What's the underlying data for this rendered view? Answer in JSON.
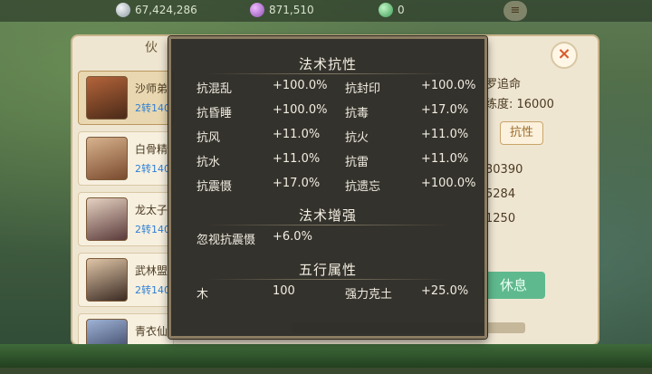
{
  "topbar": {
    "silver": "67,424,286",
    "gems": "871,510",
    "jade": "0"
  },
  "background_panel": {
    "title": "伙",
    "list": [
      {
        "name": "沙师弟",
        "level": "2转140"
      },
      {
        "name": "白骨精",
        "level": "2转140"
      },
      {
        "name": "龙太子",
        "level": "2转140"
      },
      {
        "name": "武林盟",
        "level": "2转140"
      },
      {
        "name": "青衣仙",
        "level": ""
      }
    ],
    "right": {
      "name_partial": "罗追命",
      "proficiency": "练度: 16000",
      "resist_tab": "抗性",
      "stat1": "30390",
      "stat2": "5284",
      "stat3": "1250",
      "rest_button": "休息"
    }
  },
  "popup": {
    "section1_title": "法术抗性",
    "resist_rows": [
      {
        "l1": "抗混乱",
        "v1": "+100.0%",
        "l2": "抗封印",
        "v2": "+100.0%"
      },
      {
        "l1": "抗昏睡",
        "v1": "+100.0%",
        "l2": "抗毒",
        "v2": "+17.0%"
      },
      {
        "l1": "抗风",
        "v1": "+11.0%",
        "l2": "抗火",
        "v2": "+11.0%"
      },
      {
        "l1": "抗水",
        "v1": "+11.0%",
        "l2": "抗雷",
        "v2": "+11.0%"
      },
      {
        "l1": "抗震慑",
        "v1": "+17.0%",
        "l2": "抗遗忘",
        "v2": "+100.0%"
      }
    ],
    "section2_title": "法术增强",
    "enhance": {
      "label": "忽视抗震慑",
      "value": "+6.0%"
    },
    "section3_title": "五行属性",
    "element": {
      "l1": "木",
      "v1": "100",
      "l2": "强力克土",
      "v2": "+25.0%"
    }
  }
}
